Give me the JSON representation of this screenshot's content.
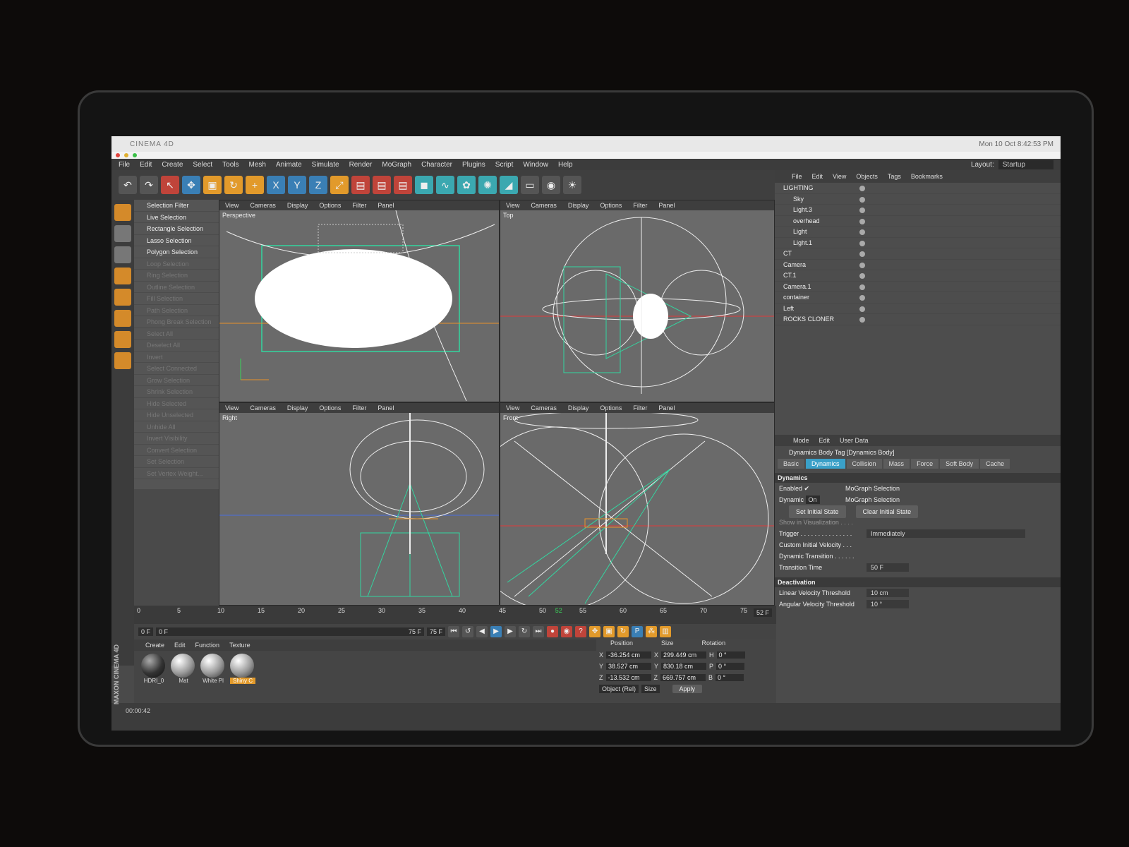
{
  "app": {
    "name": "CINEMA 4D",
    "clock": "Mon 10 Oct 8:42:53 PM"
  },
  "menu": [
    "File",
    "Edit",
    "Create",
    "Select",
    "Tools",
    "Mesh",
    "Animate",
    "Simulate",
    "Render",
    "MoGraph",
    "Character",
    "Plugins",
    "Script",
    "Window",
    "Help"
  ],
  "layout": {
    "label": "Layout:",
    "value": "Startup"
  },
  "selection_menu": [
    "Selection Filter",
    "Live Selection",
    "Rectangle Selection",
    "Lasso Selection",
    "Polygon Selection",
    "Loop Selection",
    "Ring Selection",
    "Outline Selection",
    "Fill Selection",
    "Path Selection",
    "Phong Break Selection",
    "Select All",
    "Deselect All",
    "Invert",
    "Select Connected",
    "Grow Selection",
    "Shrink Selection",
    "Hide Selected",
    "Hide Unselected",
    "Unhide All",
    "Invert Visibility",
    "Convert Selection",
    "Set Selection",
    "Set Vertex Weight..."
  ],
  "viewport_menu": [
    "View",
    "Cameras",
    "Display",
    "Options",
    "Filter",
    "Panel"
  ],
  "viewports": {
    "perspective": "Perspective",
    "top": "Top",
    "right": "Right",
    "front": "Front"
  },
  "object_manager": {
    "menu": [
      "File",
      "Edit",
      "View",
      "Objects",
      "Tags",
      "Bookmarks"
    ],
    "objects": [
      {
        "name": "LIGHTING",
        "indent": 0
      },
      {
        "name": "Sky",
        "indent": 1
      },
      {
        "name": "Light.3",
        "indent": 1
      },
      {
        "name": "overhead",
        "indent": 1
      },
      {
        "name": "Light",
        "indent": 1
      },
      {
        "name": "Light.1",
        "indent": 1
      },
      {
        "name": "CT",
        "indent": 0
      },
      {
        "name": "Camera",
        "indent": 0
      },
      {
        "name": "CT.1",
        "indent": 0
      },
      {
        "name": "Camera.1",
        "indent": 0
      },
      {
        "name": "container",
        "indent": 0
      },
      {
        "name": "Left",
        "indent": 0
      },
      {
        "name": "ROCKS CLONER",
        "indent": 0
      }
    ]
  },
  "attributes": {
    "menu": [
      "Mode",
      "Edit",
      "User Data"
    ],
    "title": "Dynamics Body Tag [Dynamics Body]",
    "tabs": [
      "Basic",
      "Dynamics",
      "Collision",
      "Mass",
      "Force",
      "Soft Body",
      "Cache"
    ],
    "section": "Dynamics",
    "enabled": "Enabled",
    "dynamic_label": "Dynamic",
    "dynamic_value": "On",
    "mograph_selection": "MoGraph Selection",
    "set_initial": "Set Initial State",
    "clear_initial": "Clear Initial State",
    "show_vis": "Show in Visualization . . . .",
    "trigger_label": "Trigger . . . . . . . . . . . . . . .",
    "trigger_value": "Immediately",
    "custom_vel": "Custom Initial Velocity . . .",
    "dyn_transition": "Dynamic Transition . . . . . .",
    "transition_label": "Transition Time",
    "transition_value": "50 F",
    "deactivation": "Deactivation",
    "lin_label": "Linear Velocity Threshold",
    "lin_value": "10 cm",
    "ang_label": "Angular Velocity Threshold",
    "ang_value": "10 °"
  },
  "timeline": {
    "ticks": [
      "0",
      "5",
      "10",
      "15",
      "20",
      "25",
      "30",
      "35",
      "40",
      "45",
      "50",
      "52",
      "55",
      "60",
      "65",
      "70",
      "75"
    ],
    "end": "52 F",
    "start_field": "0 F",
    "range_start": "0 F",
    "range_end": "75 F",
    "max_field": "75 F",
    "current": 52
  },
  "materials": {
    "menu": [
      "Create",
      "Edit",
      "Function",
      "Texture"
    ],
    "items": [
      "HDRI_0",
      "Mat",
      "White Pl",
      "Shiny C"
    ]
  },
  "coordinates": {
    "headers": [
      "Position",
      "Size",
      "Rotation"
    ],
    "rows": [
      {
        "a": "X",
        "pos": "-36.254 cm",
        "b": "X",
        "size": "299.449 cm",
        "c": "H",
        "rot": "0 °"
      },
      {
        "a": "Y",
        "pos": "38.527 cm",
        "b": "Y",
        "size": "830.18 cm",
        "c": "P",
        "rot": "0 °"
      },
      {
        "a": "Z",
        "pos": "-13.532 cm",
        "b": "Z",
        "size": "669.757 cm",
        "c": "B",
        "rot": "0 °"
      }
    ],
    "mode": "Object (Rel)",
    "size_mode": "Size",
    "apply": "Apply"
  },
  "status": {
    "time": "00:00:42"
  },
  "brand": "MAXON CINEMA 4D"
}
